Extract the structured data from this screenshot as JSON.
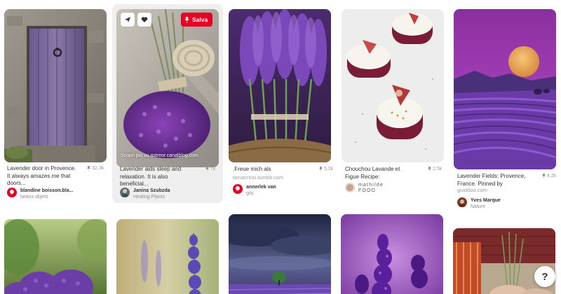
{
  "pins": [
    {
      "description": "Lavender door in Provence. It always amazes me that doors...",
      "saves": "32,3k",
      "user_name": "blandine boisson.bla...",
      "board": "beaux objets",
      "image": "lavender-door"
    },
    {
      "description": "Lavender aids sleep and relaxation. It is also beneficial...",
      "saves": "7k",
      "user_name": "Janina Szubzda",
      "board": "Healing Plants",
      "image": "lavender-bundle-twine",
      "overlay": {
        "save_label": "Salva",
        "source_text": "Scopri più su astreor.canalblog.com",
        "send_icon": "send-icon",
        "heart_icon": "heart-icon",
        "pin_icon": "pin-icon"
      }
    },
    {
      "description": ".Freue mich als",
      "domain": "tinnacrissi.tumblr.com",
      "saves": "5,2k",
      "user_name": "annerlek van",
      "board": "gils",
      "image": "lavender-bundles-basket"
    },
    {
      "description": "Chouchou Lavande et Figue Recipe:",
      "saves": "2,5k",
      "user_line1": "mathilde",
      "user_line2": "FOOD",
      "image": "fig-desserts"
    },
    {
      "description": "Lavender Fields: Provence, France. Pinned by",
      "domain": "guiddoo.com",
      "saves": "4,2k",
      "user_name": "Yves Marque",
      "board": "Nature",
      "image": "lavender-field-moon"
    }
  ],
  "bottom_images": [
    "lavender-bush-garden",
    "lavender-stalk-closeup",
    "storm-lavender-tree",
    "lavender-flowers-purple",
    "lavender-hands-chair"
  ],
  "help_button": {
    "label": "?"
  },
  "colors": {
    "accent": "#e60023",
    "lavender": "#7a4fb0",
    "text": "#333333",
    "muted": "#9a9a9a"
  }
}
